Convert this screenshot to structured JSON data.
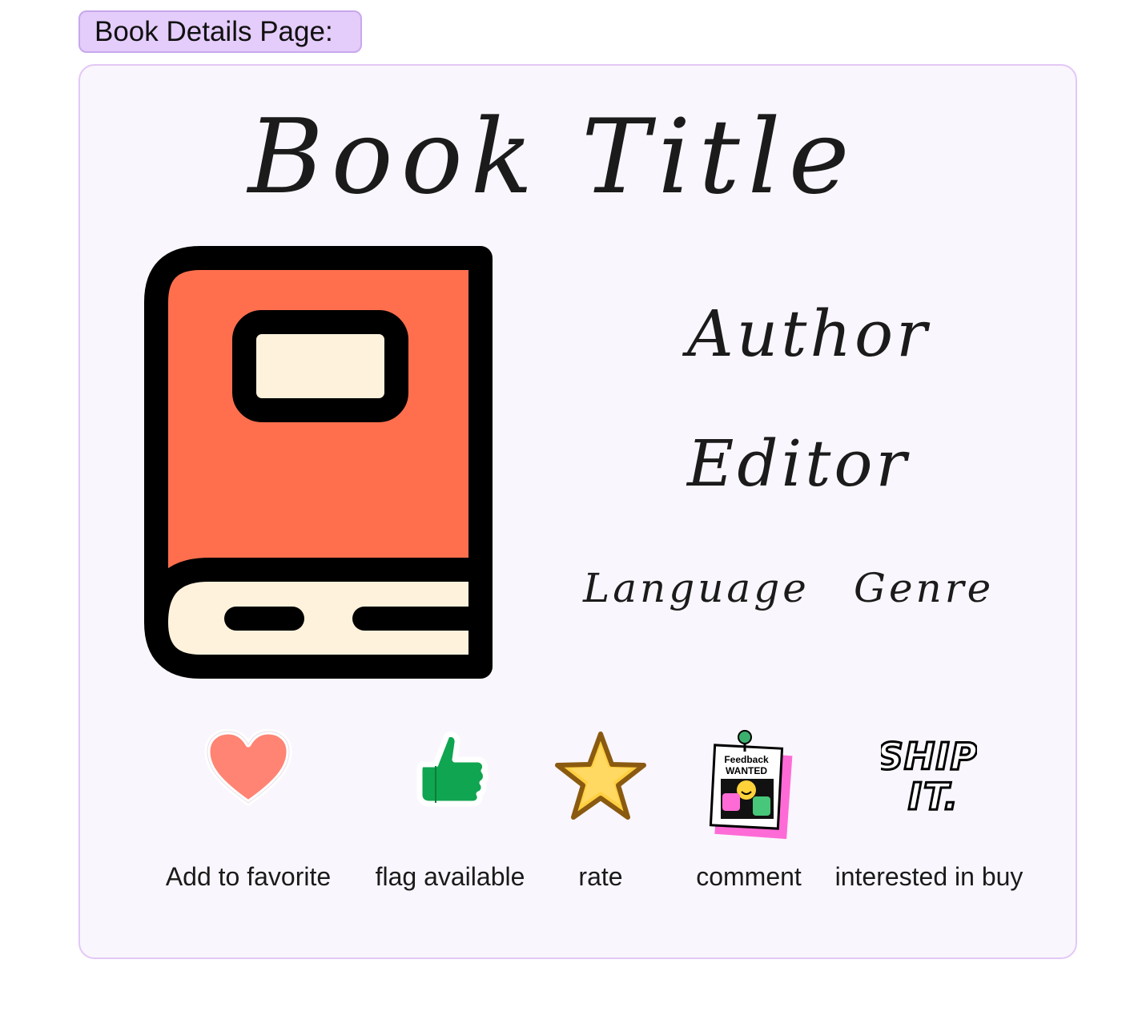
{
  "page_label": "Book Details Page:",
  "book": {
    "title": "Book Title",
    "author": "Author",
    "editor": "Editor",
    "language": "Language",
    "genre": "Genre"
  },
  "actions": [
    {
      "label": "Add to favorite",
      "icon": "heart-icon"
    },
    {
      "label": "flag available",
      "icon": "thumbs-up-icon"
    },
    {
      "label": "rate",
      "icon": "star-icon"
    },
    {
      "label": "comment",
      "icon": "feedback-wanted-icon",
      "icon_text": [
        "Feedback",
        "WANTED"
      ]
    },
    {
      "label": "interested in buy",
      "icon": "ship-it-icon",
      "icon_text": [
        "SHIP",
        "IT."
      ]
    }
  ],
  "colors": {
    "label_bg": "#e4ccfb",
    "card_bg": "#f9f6fd",
    "card_border": "#e3c8f6",
    "book_cover": "#ff6f4e",
    "book_pages": "#fff2dc",
    "heart": "#ff8474",
    "thumb": "#10a550",
    "star": "#ffcf40"
  }
}
